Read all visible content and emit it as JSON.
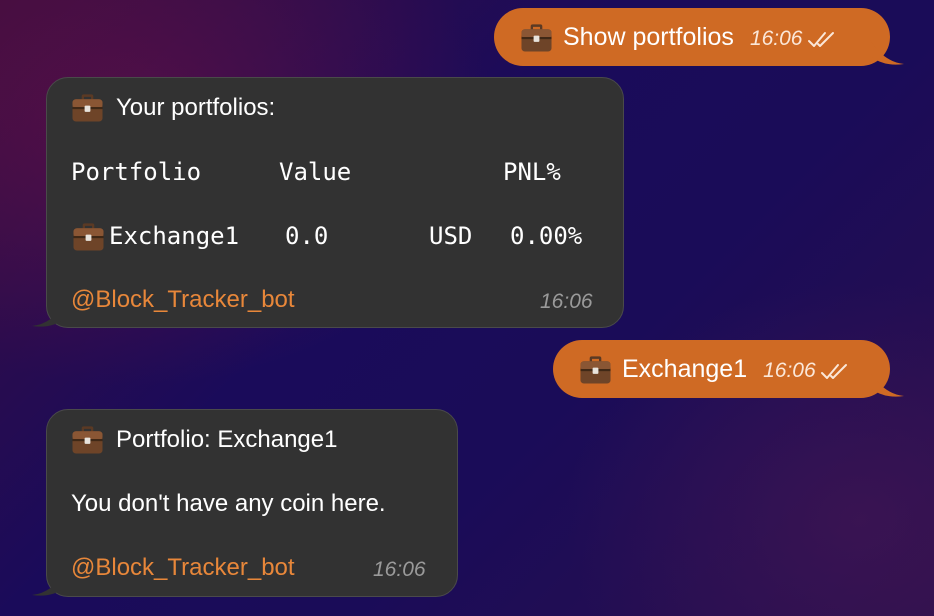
{
  "messages": [
    {
      "direction": "out",
      "icon": "briefcase-icon",
      "text": "Show portfolios",
      "time": "16:06",
      "status": "read"
    },
    {
      "direction": "in",
      "title": "Your portfolios:",
      "table": {
        "headers": [
          "Portfolio",
          "Value",
          "PNL%"
        ],
        "rows": [
          {
            "name": "Exchange1",
            "value": "0.0",
            "currency": "USD",
            "pnl": "0.00%"
          }
        ]
      },
      "via": "@Block_Tracker_bot",
      "time": "16:06"
    },
    {
      "direction": "out",
      "icon": "briefcase-icon",
      "text": "Exchange1",
      "time": "16:06",
      "status": "read"
    },
    {
      "direction": "in",
      "title": "Portfolio: Exchange1",
      "body": "You don't have any coin here.",
      "via": "@Block_Tracker_bot",
      "time": "16:06"
    }
  ],
  "colors": {
    "outgoing_bubble": "#cf6a24",
    "incoming_bubble": "#323232",
    "link": "#e8873a"
  }
}
